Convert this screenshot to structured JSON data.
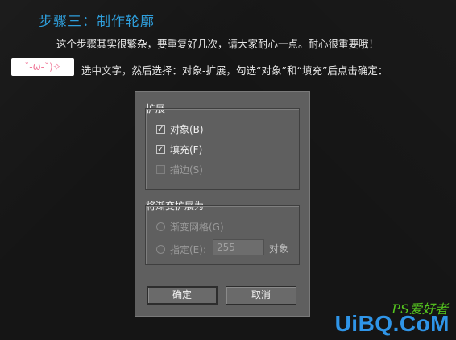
{
  "step_title": "步骤三：制作轮廓",
  "intro_line": "这个步骤其实很繁杂，要重复好几次，请大家耐心一点。耐心很重要哦！",
  "emoticon_text": "ˇ-ω-ˇ)✧",
  "instruction_line": "选中文字，然后选择：对象-扩展，勾选“对象”和“填充”后点击确定：",
  "dialog": {
    "expand_group": {
      "title": "扩展",
      "object_label": "对象(B)",
      "object_checked": true,
      "fill_label": "填充(F)",
      "fill_checked": true,
      "stroke_label": "描边(S)",
      "stroke_checked": false,
      "stroke_enabled": false
    },
    "gradient_group": {
      "title": "将渐变扩展为",
      "gradient_mesh_label": "渐变网格(G)",
      "specify_label": "指定(E):",
      "specify_value": "255",
      "specify_suffix": "对象"
    },
    "ok_label": "确定",
    "cancel_label": "取消"
  },
  "watermark": {
    "site_top": "PS爱好者",
    "site_main": "UiBQ.CoM"
  },
  "icons": {
    "check": "checkmark-icon",
    "radio": "radio-icon"
  }
}
